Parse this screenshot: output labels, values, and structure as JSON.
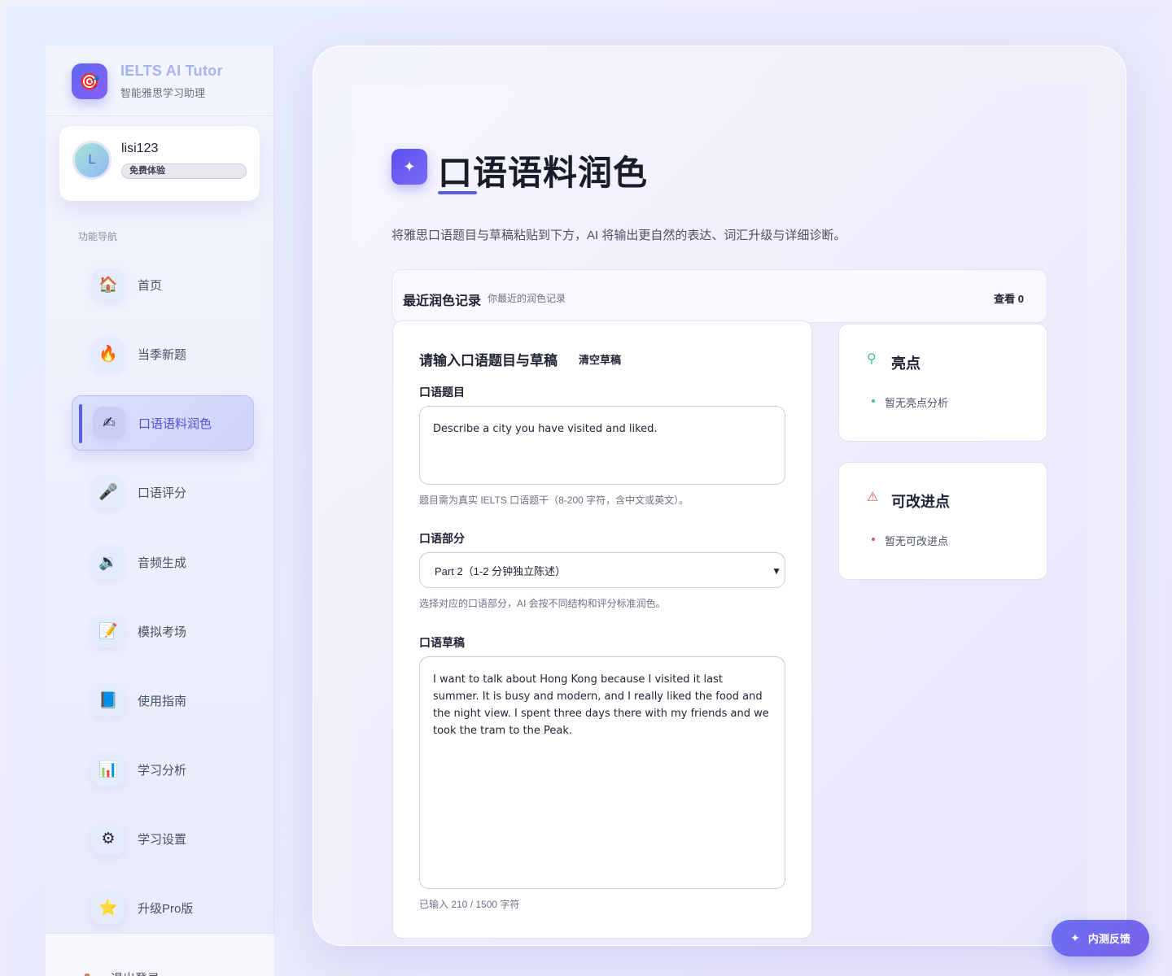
{
  "brand": {
    "title": "IELTS AI Tutor",
    "subtitle": "智能雅思学习助理",
    "logo_icon": "target-icon"
  },
  "user": {
    "avatar_letter": "L",
    "name": "lisi123",
    "plan": "免费体验"
  },
  "nav": {
    "heading": "功能导航",
    "items": [
      {
        "label": "首页",
        "icon": "🏠",
        "icon_name": "home-icon"
      },
      {
        "label": "当季新题",
        "icon": "🔥",
        "icon_name": "fire-icon"
      },
      {
        "label": "口语语料润色",
        "icon": "✍",
        "icon_name": "writing-hand-icon",
        "active": true
      },
      {
        "label": "口语评分",
        "icon": "🎤",
        "icon_name": "microphone-icon"
      },
      {
        "label": "音频生成",
        "icon": "🔉",
        "icon_name": "speaker-icon"
      },
      {
        "label": "模拟考场",
        "icon": "📝",
        "icon_name": "memo-icon"
      },
      {
        "label": "使用指南",
        "icon": "📘",
        "icon_name": "book-icon"
      },
      {
        "label": "学习分析",
        "icon": "📊",
        "icon_name": "bar-chart-icon"
      },
      {
        "label": "学习设置",
        "icon": "⚙",
        "icon_name": "gear-icon"
      },
      {
        "label": "升级Pro版",
        "icon": "⭐",
        "icon_name": "star-icon"
      }
    ],
    "logout": "退出登录"
  },
  "page": {
    "title": "口语语料润色",
    "description": "将雅思口语题目与草稿粘贴到下方，AI 将输出更自然的表达、词汇升级与详细诊断。"
  },
  "recent": {
    "title": "最近润色记录",
    "subtitle": "你最近的润色记录",
    "view_label": "查看 0"
  },
  "form": {
    "heading": "请输入口语题目与草稿",
    "clear_label": "清空草稿",
    "topic_label": "口语题目",
    "topic_value": "Describe a city you have visited and liked.",
    "topic_hint": "题目需为真实 IELTS 口语题干（8-200 字符，含中文或英文）。",
    "part_label": "口语部分",
    "part_value": "Part 2（1-2 分钟独立陈述）",
    "part_hint": "选择对应的口语部分，AI 会按不同结构和评分标准润色。",
    "draft_label": "口语草稿",
    "draft_value": "I want to talk about Hong Kong because I visited it last summer. It is busy and modern, and I really liked the food and the night view. I spent three days there with my friends and we took the tram to the Peak.",
    "draft_count": "已输入 210 / 1500 字符"
  },
  "highlights": {
    "title": "亮点",
    "empty": "暂无亮点分析",
    "icon_name": "award-icon",
    "color": "#3fbf8a"
  },
  "improvements": {
    "title": "可改进点",
    "empty": "暂无可改进点",
    "icon_name": "warning-icon",
    "color": "#e25555"
  },
  "feedback": {
    "label": "内测反馈",
    "icon_name": "sparkle-icon"
  }
}
